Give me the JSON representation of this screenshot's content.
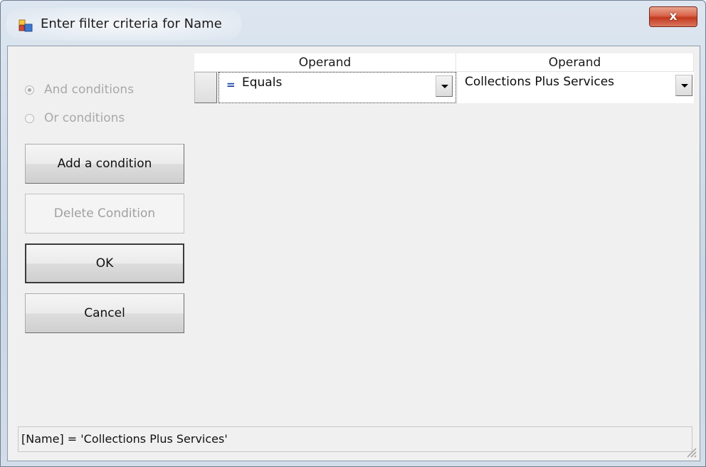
{
  "window": {
    "title": "Enter filter criteria for Name",
    "close_label": "x",
    "accent_color": "#c2391f"
  },
  "conditions": {
    "and_label": "And conditions",
    "or_label": "Or conditions",
    "selected": "and",
    "enabled": false
  },
  "buttons": {
    "add_label": "Add a condition",
    "delete_label": "Delete Condition",
    "ok_label": "OK",
    "cancel_label": "Cancel"
  },
  "grid": {
    "headers": [
      "Operand",
      "Operand"
    ],
    "rows": [
      {
        "operator_symbol": "=",
        "operator_label": "Equals",
        "value": "Collections Plus Services"
      }
    ]
  },
  "status": {
    "expression": "[Name] = 'Collections Plus Services'"
  },
  "icons": {
    "app": "window-app-icon",
    "close": "close-icon",
    "dropdown": "chevron-down-icon",
    "grip": "resize-grip-icon"
  }
}
